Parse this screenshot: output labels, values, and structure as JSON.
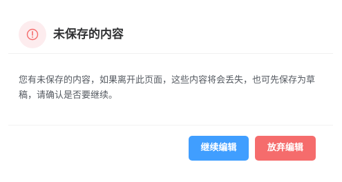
{
  "dialog": {
    "title": "未保存的内容",
    "icon": "warning-circle-icon",
    "message": "您有未保存的内容，如果离开此页面，这些内容将会丢失，也可先保存为草稿，请确认是否要继续。",
    "buttons": {
      "continue_label": "继续编辑",
      "discard_label": "放弃编辑"
    }
  },
  "colors": {
    "icon_bg": "#fdecee",
    "icon_stroke": "#f56c6c",
    "primary": "#409eff",
    "danger": "#f56c6c"
  }
}
